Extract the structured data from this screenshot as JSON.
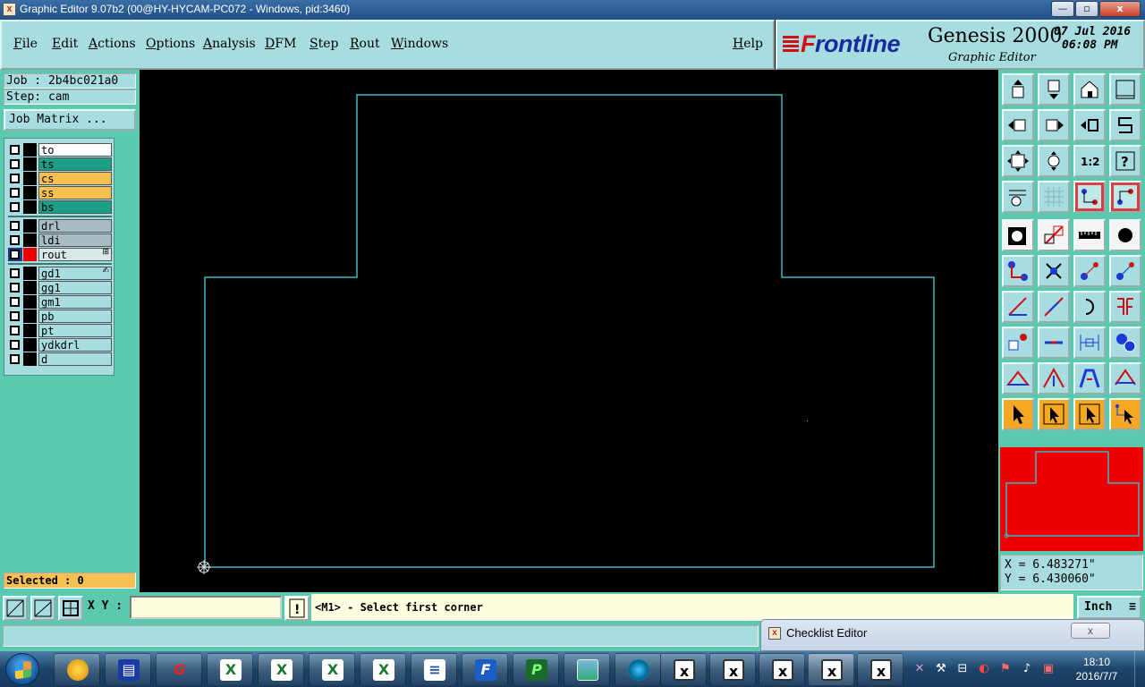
{
  "window": {
    "title": "Graphic Editor 9.07b2 (00@HY-HYCAM-PC072 - Windows, pid:3460)",
    "minimize": "—",
    "maximize": "▫",
    "close": "x"
  },
  "menu": {
    "items": [
      "File",
      "Edit",
      "Actions",
      "Options",
      "Analysis",
      "DFM",
      "Step",
      "Rout",
      "Windows"
    ],
    "help": "Help"
  },
  "brand": {
    "logo_first": "F",
    "logo_rest": "rontline",
    "product": "Genesis 2000",
    "subtitle": "Graphic Editor",
    "date": "07 Jul 2016",
    "time": "06:08 PM"
  },
  "left": {
    "job": "Job : 2b4bc021a0",
    "step": "Step: cam",
    "job_matrix": "Job Matrix ...",
    "selected": "Selected : 0"
  },
  "layers": [
    {
      "name": "to",
      "color": "#ffffff",
      "box": "#000000"
    },
    {
      "name": "ts",
      "color": "#1e9e86",
      "box": "#000000"
    },
    {
      "name": "cs",
      "color": "#f8c050",
      "box": "#000000"
    },
    {
      "name": "ss",
      "color": "#f8c050",
      "box": "#000000"
    },
    {
      "name": "bs",
      "color": "#1e9e86",
      "box": "#000000"
    },
    {
      "name": "drl",
      "color": "#a8bcc4",
      "box": "#000000"
    },
    {
      "name": "ldi",
      "color": "#a8bcc4",
      "box": "#000000"
    },
    {
      "name": "rout",
      "color": "#d8e8e8",
      "box": "#ee0000",
      "active": true,
      "mark": "⊞"
    },
    {
      "name": "gd1",
      "color": "#a7dde0",
      "box": "#000000",
      "mark": "✍"
    },
    {
      "name": "gg1",
      "color": "#a7dde0",
      "box": "#000000"
    },
    {
      "name": "gm1",
      "color": "#a7dde0",
      "box": "#000000"
    },
    {
      "name": "pb",
      "color": "#a7dde0",
      "box": "#000000"
    },
    {
      "name": "pt",
      "color": "#a7dde0",
      "box": "#000000"
    },
    {
      "name": "ydkdrl",
      "color": "#a7dde0",
      "box": "#000000"
    },
    {
      "name": "d",
      "color": "#a7dde0",
      "box": "#000000"
    }
  ],
  "coords": {
    "x": "X = 6.483271\"",
    "y": "Y = 6.430060\""
  },
  "status": {
    "xy_label": "X Y :",
    "xy_value": "",
    "warn": "!",
    "prompt": "<M1> - Select first corner",
    "unit": "Inch"
  },
  "checklist": {
    "title": "Checklist Editor",
    "close": "x"
  },
  "taskbar": {
    "time": "18:10",
    "date": "2016/7/7"
  },
  "colors": {
    "panel": "#a7dde0",
    "panel_bg": "#5ac9ad",
    "profile_line": "#3ab7c0",
    "preview": "#ee0000"
  }
}
